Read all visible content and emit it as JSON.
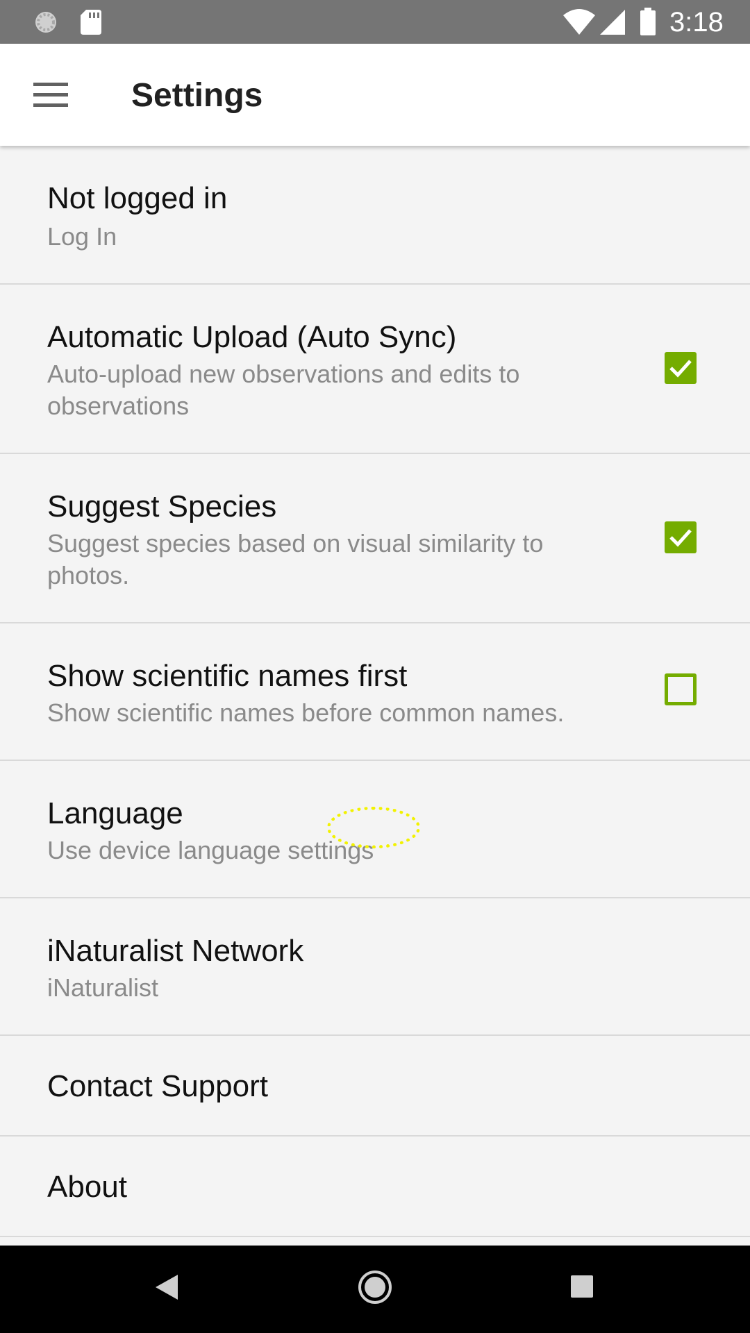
{
  "status_bar": {
    "time": "3:18",
    "icons": [
      "loading-spinner-icon",
      "sd-card-icon",
      "wifi-icon",
      "cell-signal-icon",
      "battery-icon"
    ]
  },
  "app_bar": {
    "title": "Settings",
    "menu_icon": "hamburger-menu-icon"
  },
  "settings": {
    "account": {
      "title": "Not logged in",
      "summary": "Log In"
    },
    "auto_upload": {
      "title": "Automatic Upload (Auto Sync)",
      "summary": "Auto-upload new observations and edits to observations",
      "checked": true
    },
    "suggest_species": {
      "title": "Suggest Species",
      "summary": "Suggest species based on visual similarity to photos.",
      "checked": true
    },
    "scientific_names": {
      "title": "Show scientific names first",
      "summary": "Show scientific names before common names.",
      "checked": false
    },
    "language": {
      "title": "Language",
      "summary": "Use device language settings"
    },
    "network": {
      "title": "iNaturalist Network",
      "summary": "iNaturalist"
    },
    "contact": {
      "title": "Contact Support"
    },
    "about": {
      "title": "About"
    }
  },
  "colors": {
    "accent": "#74ac00",
    "status_bar": "#757575",
    "background": "#f4f4f4"
  },
  "nav_bar": {
    "icons": [
      "back-icon",
      "home-icon",
      "recents-icon"
    ]
  }
}
